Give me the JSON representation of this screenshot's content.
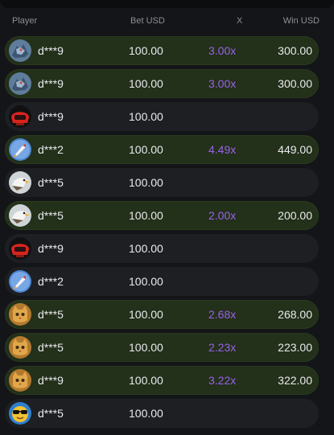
{
  "header": {
    "player": "Player",
    "bet": "Bet USD",
    "x": "X",
    "win": "Win USD"
  },
  "rows": [
    {
      "avatar": "dragon-avatar-icon",
      "player": "d***9",
      "bet": "100.00",
      "x": "3.00x",
      "win": "300.00",
      "won": true
    },
    {
      "avatar": "dragon-avatar-icon",
      "player": "d***9",
      "bet": "100.00",
      "x": "3.00x",
      "win": "300.00",
      "won": true
    },
    {
      "avatar": "red-helmet-avatar-icon",
      "player": "d***9",
      "bet": "100.00",
      "x": "",
      "win": "",
      "won": false
    },
    {
      "avatar": "rocket-avatar-icon",
      "player": "d***2",
      "bet": "100.00",
      "x": "4.49x",
      "win": "449.00",
      "won": true
    },
    {
      "avatar": "eagle-avatar-icon",
      "player": "d***5",
      "bet": "100.00",
      "x": "",
      "win": "",
      "won": false
    },
    {
      "avatar": "eagle-avatar-icon",
      "player": "d***5",
      "bet": "100.00",
      "x": "2.00x",
      "win": "200.00",
      "won": true
    },
    {
      "avatar": "red-helmet-avatar-icon",
      "player": "d***9",
      "bet": "100.00",
      "x": "",
      "win": "",
      "won": false
    },
    {
      "avatar": "rocket-avatar-icon",
      "player": "d***2",
      "bet": "100.00",
      "x": "",
      "win": "",
      "won": false
    },
    {
      "avatar": "cat-avatar-icon",
      "player": "d***5",
      "bet": "100.00",
      "x": "2.68x",
      "win": "268.00",
      "won": true
    },
    {
      "avatar": "cat-avatar-icon",
      "player": "d***5",
      "bet": "100.00",
      "x": "2.23x",
      "win": "223.00",
      "won": true
    },
    {
      "avatar": "cat-avatar-icon",
      "player": "d***9",
      "bet": "100.00",
      "x": "3.22x",
      "win": "322.00",
      "won": true
    },
    {
      "avatar": "sunglasses-avatar-icon",
      "player": "d***5",
      "bet": "100.00",
      "x": "",
      "win": "",
      "won": false
    }
  ],
  "colors": {
    "background": "#141518",
    "row_loss": "#1d1f23",
    "row_win": "#23301a",
    "multiplier": "#9a62e8",
    "header_text": "#8d8f96"
  }
}
